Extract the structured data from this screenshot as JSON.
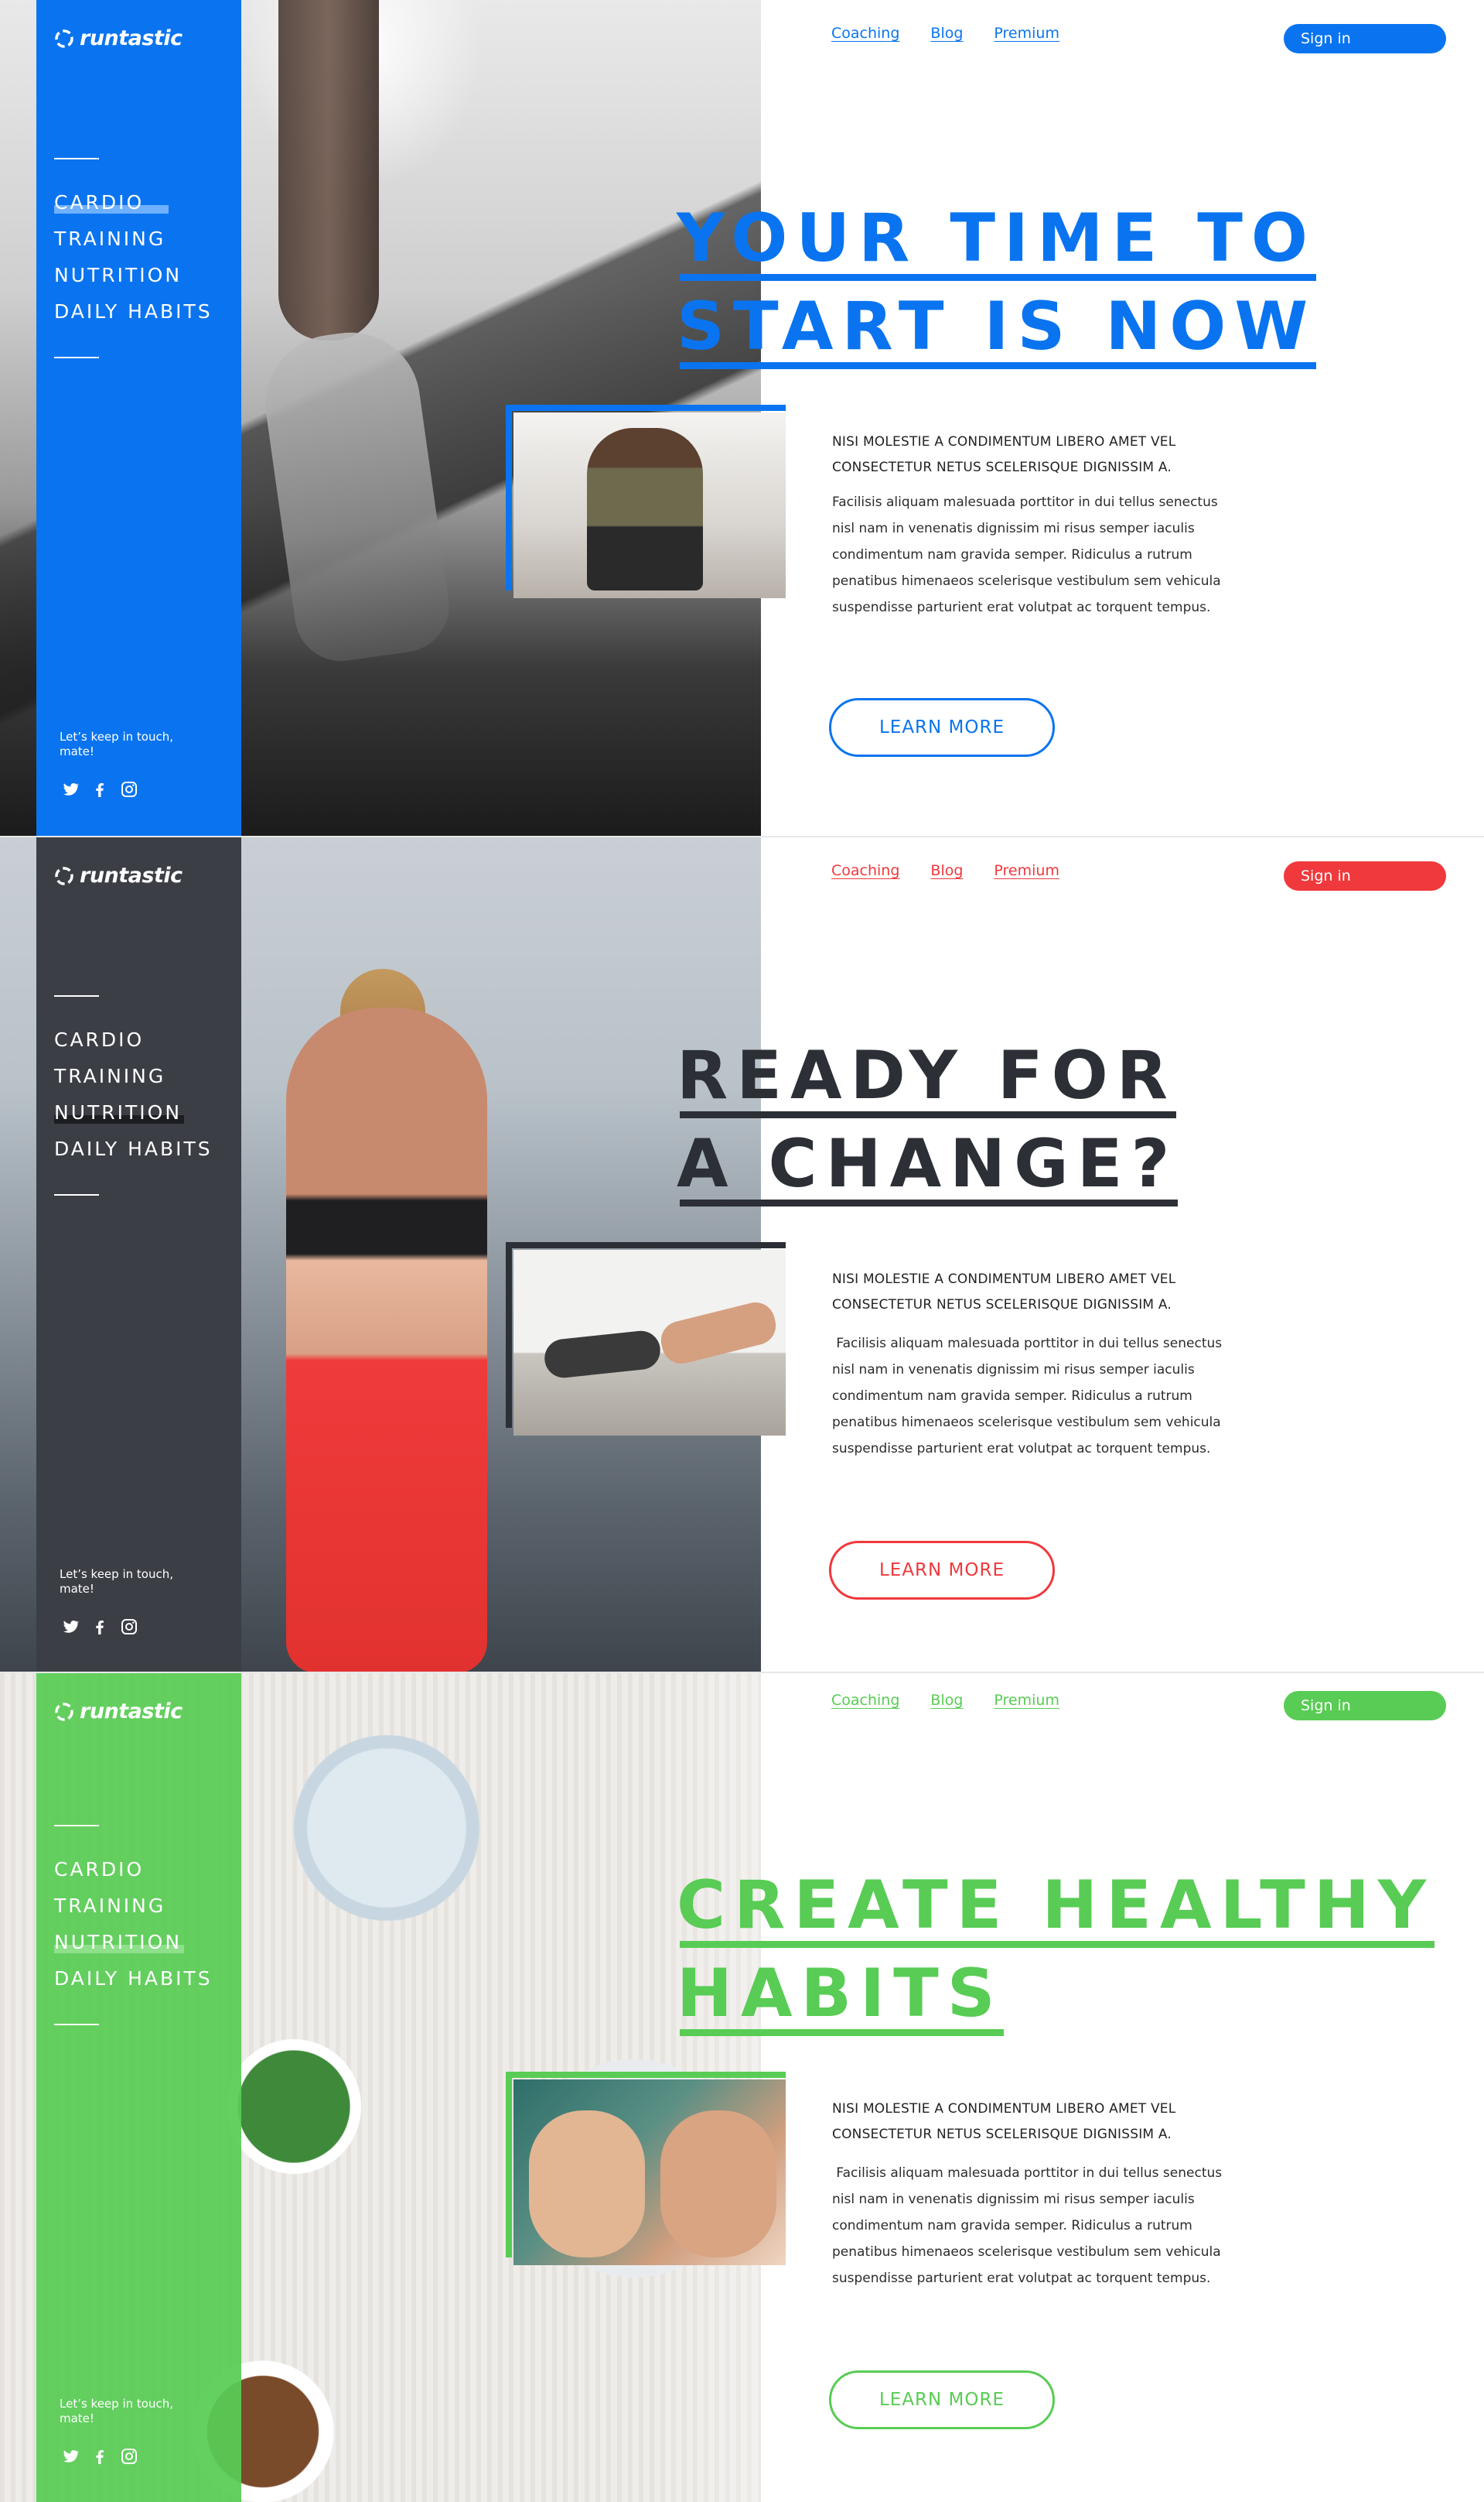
{
  "brand": {
    "name": "runtastic"
  },
  "colors": {
    "blue": "#0a74f0",
    "red": "#f0393d",
    "green": "#58cc54",
    "dark": "#2c2f36"
  },
  "nav": {
    "coaching": "Coaching",
    "blog": "Blog",
    "premium": "Premium",
    "signin": "Sign in"
  },
  "menu": [
    "CARDIO",
    "TRAINING",
    "NUTRITION",
    "DAILY HABITS"
  ],
  "keep_in_touch": "Let’s keep in touch, mate!",
  "icons": [
    "twitter-icon",
    "facebook-icon",
    "instagram-icon"
  ],
  "sections": [
    {
      "theme": "blue",
      "active_menu": "CARDIO",
      "headline": [
        "YOUR TIME TO",
        "START IS NOW"
      ],
      "intro": "NISI MOLESTIE A CONDIMENTUM LIBERO AMET VEL CONSECTETUR NETUS SCELERISQUE DIGNISSIM A.",
      "body": "Facilisis aliquam malesuada porttitor in dui tellus senectus nisl nam in venenatis dignissim mi risus semper iaculis condimentum nam gravida semper. Ridiculus a rutrum penatibus himenaeos scelerisque vestibulum sem vehicula suspendisse parturient erat volutpat ac torquent tempus.",
      "cta": "LEARN MORE"
    },
    {
      "theme": "red",
      "active_menu": "NUTRITION",
      "headline": [
        "READY FOR",
        "A CHANGE?"
      ],
      "intro": "NISI MOLESTIE A CONDIMENTUM LIBERO AMET VEL CONSECTETUR NETUS SCELERISQUE DIGNISSIM A.",
      "body": " Facilisis aliquam malesuada porttitor in dui tellus senectus nisl nam in venenatis dignissim mi risus semper iaculis condimentum nam gravida semper. Ridiculus a rutrum penatibus himenaeos scelerisque vestibulum sem vehicula suspendisse parturient erat volutpat ac torquent tempus.",
      "cta": "LEARN MORE"
    },
    {
      "theme": "green",
      "active_menu": "NUTRITION",
      "headline": [
        "CREATE HEALTHY",
        "HABITS"
      ],
      "intro": "NISI MOLESTIE A CONDIMENTUM LIBERO AMET VEL CONSECTETUR NETUS SCELERISQUE DIGNISSIM A.",
      "body": " Facilisis aliquam malesuada porttitor in dui tellus senectus nisl nam in venenatis dignissim mi risus semper iaculis condimentum nam gravida semper. Ridiculus a rutrum penatibus himenaeos scelerisque vestibulum sem vehicula suspendisse parturient erat volutpat ac torquent tempus.",
      "cta": "LEARN MORE"
    }
  ]
}
